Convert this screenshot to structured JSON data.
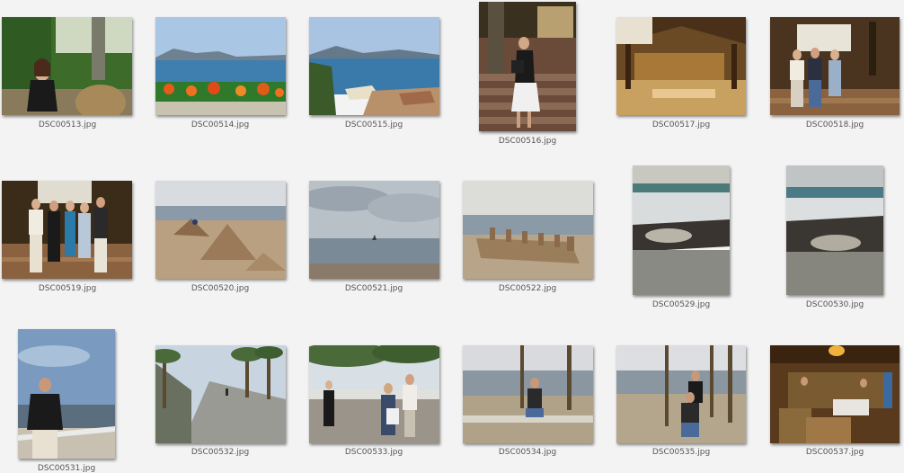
{
  "gallery": {
    "items": [
      {
        "filename": "DSC00513.jpg",
        "subject": "woman seated in wicker chair on terrace"
      },
      {
        "filename": "DSC00514.jpg",
        "subject": "bay view with orange flowers"
      },
      {
        "filename": "DSC00515.jpg",
        "subject": "bay view over coastline and rooftops"
      },
      {
        "filename": "DSC00516.jpg",
        "subject": "woman standing on stairs"
      },
      {
        "filename": "DSC00517.jpg",
        "subject": "hotel lobby interior"
      },
      {
        "filename": "DSC00518.jpg",
        "subject": "group of three standing in lobby"
      },
      {
        "filename": "DSC00519.jpg",
        "subject": "group of five standing in lobby"
      },
      {
        "filename": "DSC00520.jpg",
        "subject": "beach with sand sculptures"
      },
      {
        "filename": "DSC00521.jpg",
        "subject": "cloudy sea with boat"
      },
      {
        "filename": "DSC00522.jpg",
        "subject": "sand castle on beach"
      },
      {
        "filename": "DSC00529.jpg",
        "subject": "rocky shore with tide pool"
      },
      {
        "filename": "DSC00530.jpg",
        "subject": "rocky shore with tide pool"
      },
      {
        "filename": "DSC00531.jpg",
        "subject": "man on seaside boardwalk"
      },
      {
        "filename": "DSC00532.jpg",
        "subject": "seaside promenade with palms"
      },
      {
        "filename": "DSC00533.jpg",
        "subject": "people walking under palm trees"
      },
      {
        "filename": "DSC00534.jpg",
        "subject": "man seated on beach wall"
      },
      {
        "filename": "DSC00535.jpg",
        "subject": "couple seated by palms at beach"
      },
      {
        "filename": "DSC00537.jpg",
        "subject": "restaurant interior with band"
      }
    ]
  }
}
